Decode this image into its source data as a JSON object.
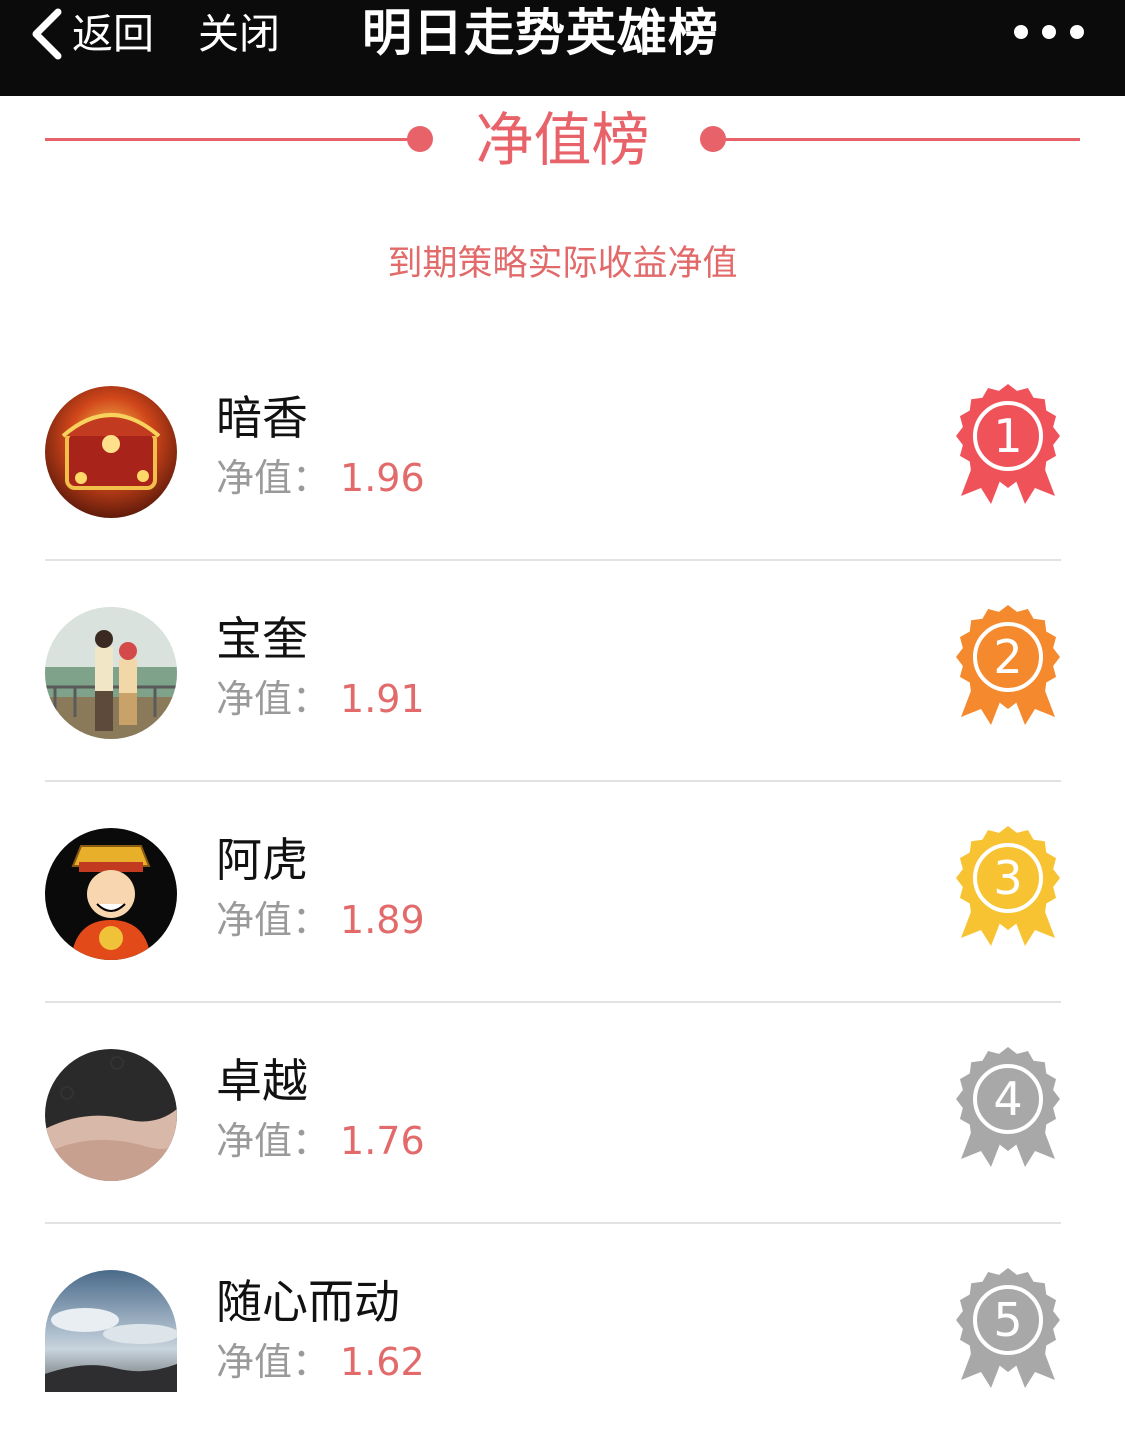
{
  "nav": {
    "back_label": "返回",
    "close_label": "关闭",
    "title": "明日走势英雄榜",
    "more_icon": "more-dots-icon"
  },
  "section": {
    "title": "净值榜",
    "subtitle": "到期策略实际收益净值"
  },
  "theme": {
    "accent": "#e8626a",
    "value_color": "#e26a6a",
    "label_color": "#9a9a9a",
    "medal_colors": [
      "#f0525a",
      "#f5892e",
      "#f7c333",
      "#a8a8a8",
      "#a8a8a8"
    ]
  },
  "ranking": [
    {
      "rank": "1",
      "name": "暗香",
      "value_label": "净值：",
      "value": "1.96",
      "avatar_icon": "treasure-box-avatar"
    },
    {
      "rank": "2",
      "name": "宝奎",
      "value_label": "净值：",
      "value": "1.91",
      "avatar_icon": "couple-balcony-avatar"
    },
    {
      "rank": "3",
      "name": "阿虎",
      "value_label": "净值：",
      "value": "1.89",
      "avatar_icon": "god-of-wealth-avatar"
    },
    {
      "rank": "4",
      "name": "卓越",
      "value_label": "净值：",
      "value": "1.76",
      "avatar_icon": "holding-hands-avatar"
    },
    {
      "rank": "5",
      "name": "随心而动",
      "value_label": "净值：",
      "value": "1.62",
      "avatar_icon": "cloudy-sky-avatar"
    }
  ]
}
